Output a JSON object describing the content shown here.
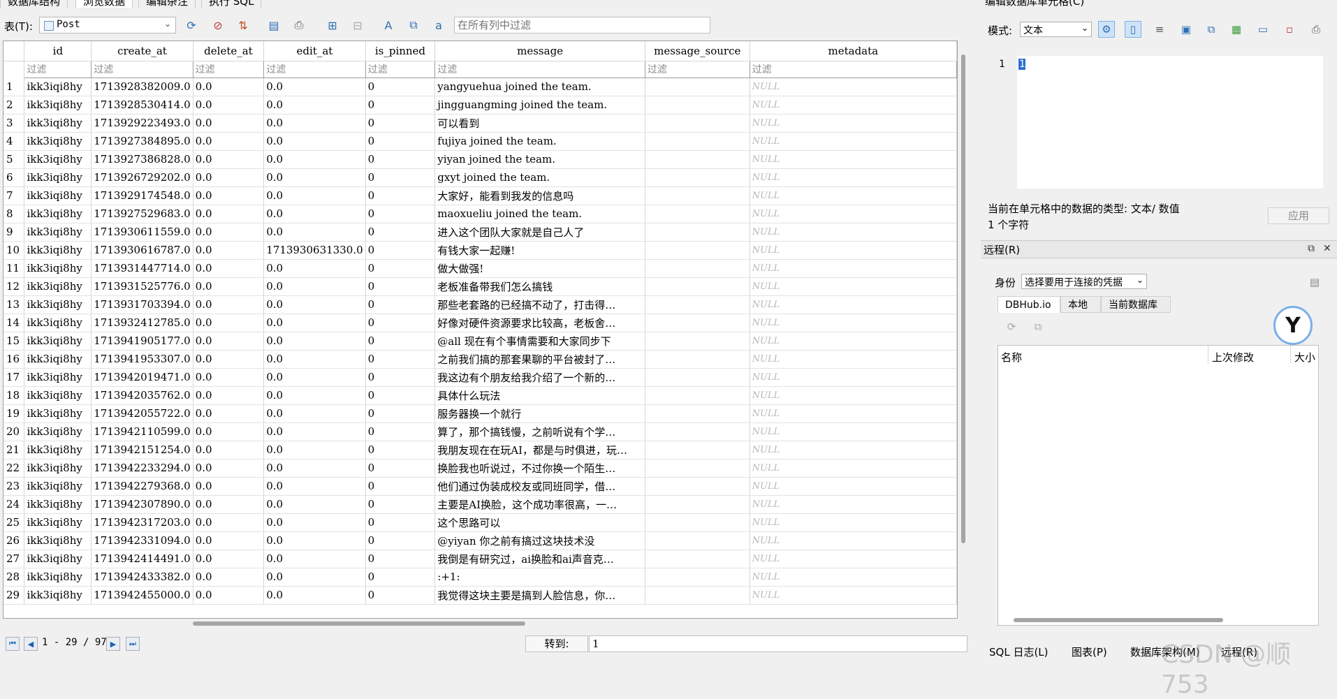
{
  "top_tabs": [
    "数据库结构",
    "浏览数据",
    "编辑杂注",
    "执行 SQL"
  ],
  "right_top_title": "编辑数据库单元格(C)",
  "toolbar": {
    "table_label": "表(T):",
    "table_name": "Post",
    "filter_all_placeholder": "在所有列中过滤"
  },
  "grid": {
    "columns": [
      "id",
      "create_at",
      "delete_at",
      "edit_at",
      "is_pinned",
      "message",
      "message_source",
      "metadata"
    ],
    "filter_placeholder": "过滤",
    "rows": [
      [
        "1",
        "ikk3iqi8hy",
        "1713928382009.0",
        "0.0",
        "0.0",
        "0",
        "yangyuehua joined the team.",
        "",
        "NULL"
      ],
      [
        "2",
        "ikk3iqi8hy",
        "1713928530414.0",
        "0.0",
        "0.0",
        "0",
        "jingguangming joined the team.",
        "",
        "NULL"
      ],
      [
        "3",
        "ikk3iqi8hy",
        "1713929223493.0",
        "0.0",
        "0.0",
        "0",
        "可以看到",
        "",
        "NULL"
      ],
      [
        "4",
        "ikk3iqi8hy",
        "1713927384895.0",
        "0.0",
        "0.0",
        "0",
        "fujiya joined the team.",
        "",
        "NULL"
      ],
      [
        "5",
        "ikk3iqi8hy",
        "1713927386828.0",
        "0.0",
        "0.0",
        "0",
        "yiyan joined the team.",
        "",
        "NULL"
      ],
      [
        "6",
        "ikk3iqi8hy",
        "1713926729202.0",
        "0.0",
        "0.0",
        "0",
        "gxyt joined the team.",
        "",
        "NULL"
      ],
      [
        "7",
        "ikk3iqi8hy",
        "1713929174548.0",
        "0.0",
        "0.0",
        "0",
        "大家好，能看到我发的信息吗",
        "",
        "NULL"
      ],
      [
        "8",
        "ikk3iqi8hy",
        "1713927529683.0",
        "0.0",
        "0.0",
        "0",
        "maoxueliu joined the team.",
        "",
        "NULL"
      ],
      [
        "9",
        "ikk3iqi8hy",
        "1713930611559.0",
        "0.0",
        "0.0",
        "0",
        "进入这个团队大家就是自己人了",
        "",
        "NULL"
      ],
      [
        "10",
        "ikk3iqi8hy",
        "1713930616787.0",
        "0.0",
        "1713930631330.0",
        "0",
        "有钱大家一起赚!",
        "",
        "NULL"
      ],
      [
        "11",
        "ikk3iqi8hy",
        "1713931447714.0",
        "0.0",
        "0.0",
        "0",
        "做大做强!",
        "",
        "NULL"
      ],
      [
        "12",
        "ikk3iqi8hy",
        "1713931525776.0",
        "0.0",
        "0.0",
        "0",
        "老板准备带我们怎么搞钱",
        "",
        "NULL"
      ],
      [
        "13",
        "ikk3iqi8hy",
        "1713931703394.0",
        "0.0",
        "0.0",
        "0",
        "那些老套路的已经搞不动了，打击得…",
        "",
        "NULL"
      ],
      [
        "14",
        "ikk3iqi8hy",
        "1713932412785.0",
        "0.0",
        "0.0",
        "0",
        "好像对硬件资源要求比较高，老板舍…",
        "",
        "NULL"
      ],
      [
        "15",
        "ikk3iqi8hy",
        "1713941905177.0",
        "0.0",
        "0.0",
        "0",
        "@all 现在有个事情需要和大家同步下",
        "",
        "NULL"
      ],
      [
        "16",
        "ikk3iqi8hy",
        "1713941953307.0",
        "0.0",
        "0.0",
        "0",
        "之前我们搞的那套果聊的平台被封了…",
        "",
        "NULL"
      ],
      [
        "17",
        "ikk3iqi8hy",
        "1713942019471.0",
        "0.0",
        "0.0",
        "0",
        "我这边有个朋友给我介绍了一个新的…",
        "",
        "NULL"
      ],
      [
        "18",
        "ikk3iqi8hy",
        "1713942035762.0",
        "0.0",
        "0.0",
        "0",
        "具体什么玩法",
        "",
        "NULL"
      ],
      [
        "19",
        "ikk3iqi8hy",
        "1713942055722.0",
        "0.0",
        "0.0",
        "0",
        "服务器换一个就行",
        "",
        "NULL"
      ],
      [
        "20",
        "ikk3iqi8hy",
        "1713942110599.0",
        "0.0",
        "0.0",
        "0",
        "算了，那个搞钱慢，之前听说有个学…",
        "",
        "NULL"
      ],
      [
        "21",
        "ikk3iqi8hy",
        "1713942151254.0",
        "0.0",
        "0.0",
        "0",
        "我朋友现在在玩AI，都是与时俱进，玩…",
        "",
        "NULL"
      ],
      [
        "22",
        "ikk3iqi8hy",
        "1713942233294.0",
        "0.0",
        "0.0",
        "0",
        "换脸我也听说过，不过你换一个陌生…",
        "",
        "NULL"
      ],
      [
        "23",
        "ikk3iqi8hy",
        "1713942279368.0",
        "0.0",
        "0.0",
        "0",
        "他们通过伪装成校友或同班同学，借…",
        "",
        "NULL"
      ],
      [
        "24",
        "ikk3iqi8hy",
        "1713942307890.0",
        "0.0",
        "0.0",
        "0",
        "主要是AI换脸，这个成功率很高，一…",
        "",
        "NULL"
      ],
      [
        "25",
        "ikk3iqi8hy",
        "1713942317203.0",
        "0.0",
        "0.0",
        "0",
        "这个思路可以",
        "",
        "NULL"
      ],
      [
        "26",
        "ikk3iqi8hy",
        "1713942331094.0",
        "0.0",
        "0.0",
        "0",
        "@yiyan 你之前有搞过这块技术没",
        "",
        "NULL"
      ],
      [
        "27",
        "ikk3iqi8hy",
        "1713942414491.0",
        "0.0",
        "0.0",
        "0",
        "我倒是有研究过，ai换脸和ai声音克…",
        "",
        "NULL"
      ],
      [
        "28",
        "ikk3iqi8hy",
        "1713942433382.0",
        "0.0",
        "0.0",
        "0",
        ":+1:",
        "",
        "NULL"
      ],
      [
        "29",
        "ikk3iqi8hy",
        "1713942455000.0",
        "0.0",
        "0.0",
        "0",
        "我觉得这块主要是搞到人脸信息，你…",
        "",
        "NULL"
      ]
    ]
  },
  "pager": {
    "range_text": "1 - 29 / 97",
    "goto_label": "转到:",
    "goto_value": "1"
  },
  "cell_editor": {
    "mode_label": "模式:",
    "mode_value": "文本",
    "line_number": "1",
    "value": "1",
    "type_text": "当前在单元格中的数据的类型: 文本/ 数值",
    "char_count": "1 个字符",
    "apply_label": "应用"
  },
  "remote": {
    "title": "远程(R)",
    "identity_label": "身份",
    "identity_value": "选择要用于连接的凭据",
    "tabs": [
      "DBHub.io",
      "本地",
      "当前数据库"
    ],
    "columns": [
      "名称",
      "上次修改",
      "大小"
    ]
  },
  "bottom_tabs": [
    "SQL 日志(L)",
    "图表(P)",
    "数据库架构(M)",
    "远程(R)"
  ],
  "watermark": "CSDN @顺753",
  "colors": {
    "accent": "#2d6fb5",
    "null_text": "#b8b8b8",
    "selection": "#2f6fd0"
  }
}
